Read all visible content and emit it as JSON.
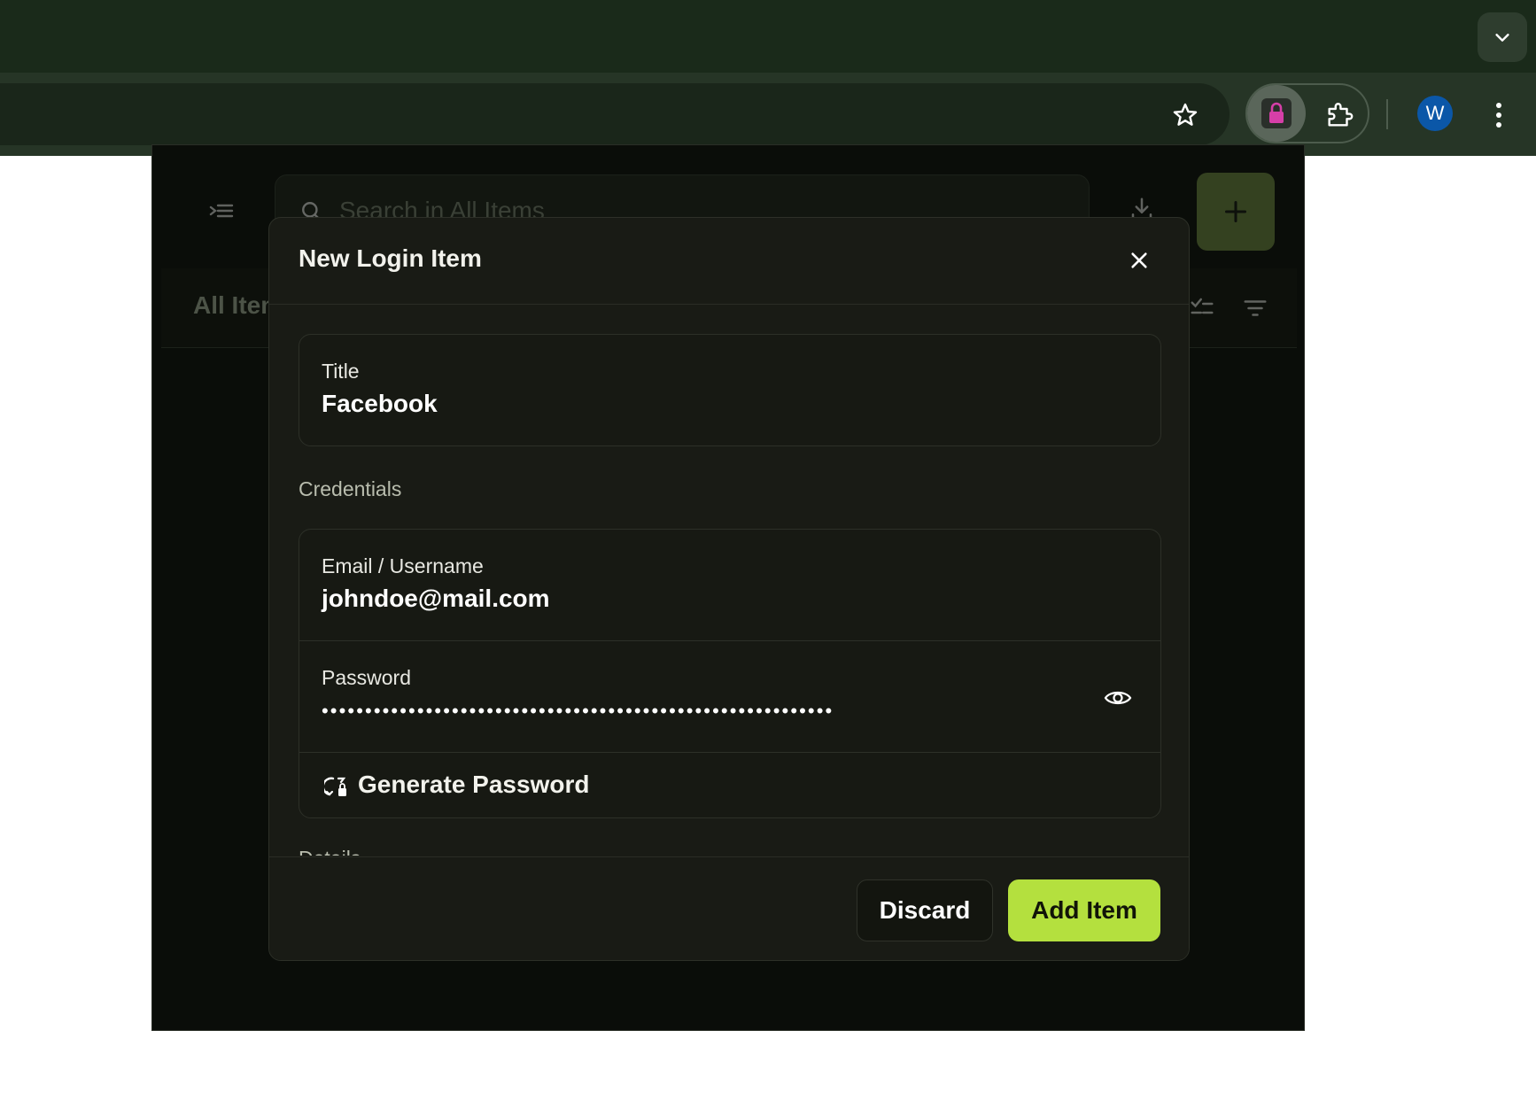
{
  "browser": {
    "avatar_letter": "W",
    "icons": [
      "chevron-down-icon",
      "star-icon",
      "lock-icon",
      "puzzle-icon",
      "kebab-menu-icon"
    ]
  },
  "background": {
    "search_placeholder": "Search in All Items",
    "list_title": "All Items"
  },
  "modal": {
    "title": "New Login Item",
    "title_field": {
      "label": "Title",
      "value": "Facebook"
    },
    "credentials_section": "Credentials",
    "email_field": {
      "label": "Email / Username",
      "value": "johndoe@mail.com"
    },
    "password_field": {
      "label": "Password",
      "value": "•••••••••••••••••••••••••••••••••••••••••••••••••••••••••••"
    },
    "generate_password_label": "Generate Password",
    "details_section": "Details",
    "discard_label": "Discard",
    "add_label": "Add Item"
  },
  "colors": {
    "accent": "#b4e03e",
    "modal_bg": "#191b15",
    "browser_bg": "#1a2a1a"
  }
}
